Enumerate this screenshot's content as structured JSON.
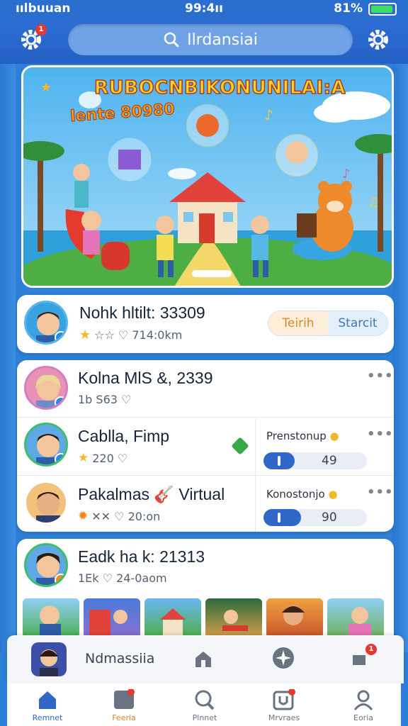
{
  "status_bar": {
    "carrier": "ıılbuuan",
    "time": "99:4ıı",
    "battery": "81%"
  },
  "header": {
    "search_text": "Ilrdansiai"
  },
  "banner": {
    "title": "RUBOCNBIKONUNILAI:A",
    "subtitle": "lente 80980"
  },
  "card_top": {
    "name": "Nohk hltilt: 33309",
    "meta": "☆☆ ♡ 714:0km",
    "seg_a": "Teirih",
    "seg_b": "Starcit"
  },
  "list": [
    {
      "name": "Kolna MlS &, 2339",
      "meta": "1b S63 ♡",
      "status_color": "#2e86de"
    },
    {
      "name": "Cablla, Fimp",
      "meta": "220 ♡",
      "plan_label": "Prenstonup",
      "plan_value": "49",
      "plan_fraction": 0.3,
      "status_color": "#2e86de"
    },
    {
      "name": "Pakalmas 🎸 Virtual",
      "meta": "✕✕ ♡ 20:on",
      "plan_label": "Konostonjo",
      "plan_value": "90",
      "plan_fraction": 0.36,
      "status_color": "#2e86de"
    }
  ],
  "card_bottom": {
    "name": "Eadk  ha k: 21313",
    "meta": "1Ek ♡ 24-0aom",
    "status_color": "#f08a1c"
  },
  "mini_player": {
    "name": "Ndmassiia"
  },
  "nav": {
    "items": [
      "Remnet",
      "Feeria",
      "Plnnet",
      "Mrvraes",
      "Eoria"
    ]
  },
  "colors": {
    "accent": "#2f66c7",
    "header": "#2460c4",
    "alert": "#e6382e"
  }
}
